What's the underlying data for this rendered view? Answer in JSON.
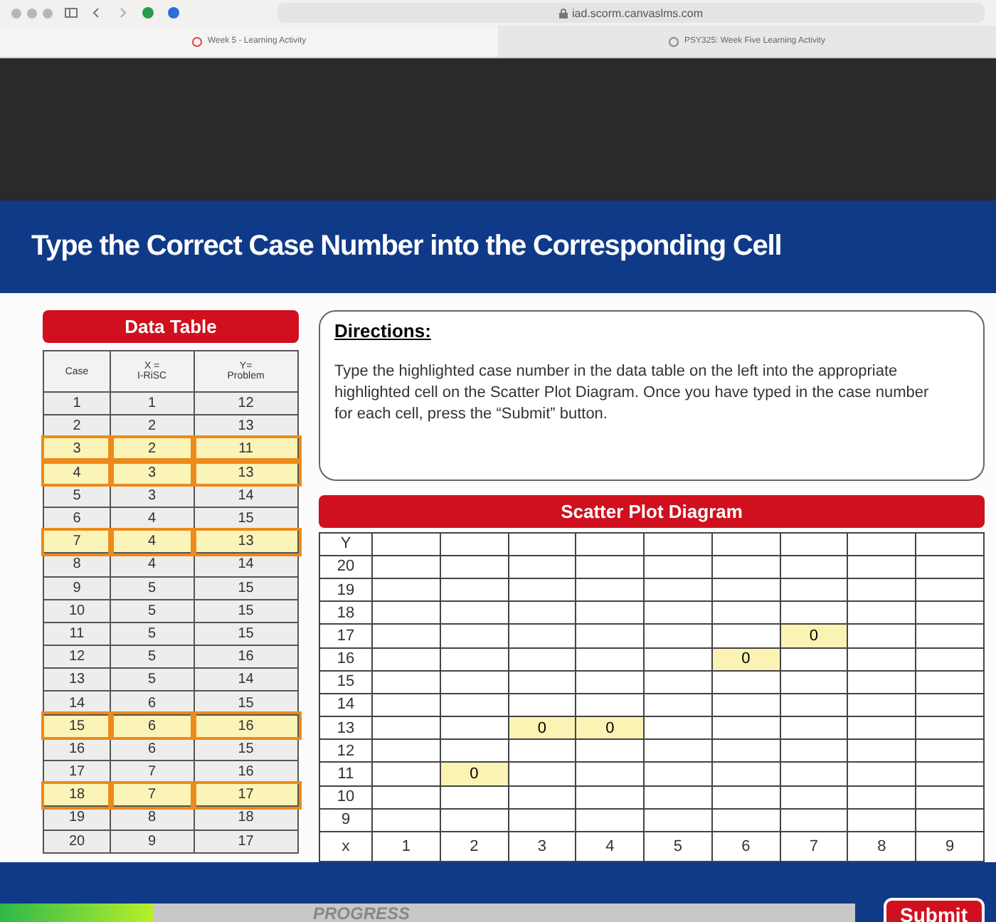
{
  "browser": {
    "url": "iad.scorm.canvaslms.com",
    "tabs": [
      {
        "label": "Week 5 - Learning Activity",
        "selected": true
      },
      {
        "label": "PSY325: Week Five Learning Activity",
        "selected": false
      }
    ]
  },
  "title": "Type the Correct Case Number into the Corresponding Cell",
  "data_table": {
    "title": "Data Table",
    "columns": [
      "Case",
      "X =\nI-RiSC",
      "Y=\nProblem"
    ],
    "rows": [
      {
        "cells": [
          "1",
          "1",
          "12"
        ],
        "highlighted": false
      },
      {
        "cells": [
          "2",
          "2",
          "13"
        ],
        "highlighted": false
      },
      {
        "cells": [
          "3",
          "2",
          "11"
        ],
        "highlighted": true
      },
      {
        "cells": [
          "4",
          "3",
          "13"
        ],
        "highlighted": true
      },
      {
        "cells": [
          "5",
          "3",
          "14"
        ],
        "highlighted": false
      },
      {
        "cells": [
          "6",
          "4",
          "15"
        ],
        "highlighted": false
      },
      {
        "cells": [
          "7",
          "4",
          "13"
        ],
        "highlighted": true
      },
      {
        "cells": [
          "8",
          "4",
          "14"
        ],
        "highlighted": false
      },
      {
        "cells": [
          "9",
          "5",
          "15"
        ],
        "highlighted": false
      },
      {
        "cells": [
          "10",
          "5",
          "15"
        ],
        "highlighted": false
      },
      {
        "cells": [
          "11",
          "5",
          "15"
        ],
        "highlighted": false
      },
      {
        "cells": [
          "12",
          "5",
          "16"
        ],
        "highlighted": false
      },
      {
        "cells": [
          "13",
          "5",
          "14"
        ],
        "highlighted": false
      },
      {
        "cells": [
          "14",
          "6",
          "15"
        ],
        "highlighted": false
      },
      {
        "cells": [
          "15",
          "6",
          "16"
        ],
        "highlighted": true
      },
      {
        "cells": [
          "16",
          "6",
          "15"
        ],
        "highlighted": false
      },
      {
        "cells": [
          "17",
          "7",
          "16"
        ],
        "highlighted": false
      },
      {
        "cells": [
          "18",
          "7",
          "17"
        ],
        "highlighted": true
      },
      {
        "cells": [
          "19",
          "8",
          "18"
        ],
        "highlighted": false
      },
      {
        "cells": [
          "20",
          "9",
          "17"
        ],
        "highlighted": false
      }
    ]
  },
  "directions": {
    "heading": "Directions:",
    "text": "Type the highlighted case number in the data table on the left into the appropriate highlighted cell on the Scatter Plot Diagram. Once you have typed in the case number for each cell, press the “Submit” button."
  },
  "scatter": {
    "title": "Scatter Plot Diagram",
    "y_header": "Y",
    "x_header": "x",
    "x_labels": [
      "1",
      "2",
      "3",
      "4",
      "5",
      "6",
      "7",
      "8",
      "9"
    ],
    "rows": [
      {
        "label": "20",
        "cells": [
          null,
          null,
          null,
          null,
          null,
          null,
          null,
          null,
          null
        ]
      },
      {
        "label": "19",
        "cells": [
          null,
          null,
          null,
          null,
          null,
          null,
          null,
          null,
          null
        ]
      },
      {
        "label": "18",
        "cells": [
          null,
          null,
          null,
          null,
          null,
          null,
          null,
          null,
          null
        ]
      },
      {
        "label": "17",
        "cells": [
          null,
          null,
          null,
          null,
          null,
          null,
          {
            "value": "0"
          },
          null,
          null
        ]
      },
      {
        "label": "16",
        "cells": [
          null,
          null,
          null,
          null,
          null,
          {
            "value": "0"
          },
          null,
          null,
          null
        ]
      },
      {
        "label": "15",
        "cells": [
          null,
          null,
          null,
          null,
          null,
          null,
          null,
          null,
          null
        ]
      },
      {
        "label": "14",
        "cells": [
          null,
          null,
          null,
          null,
          null,
          null,
          null,
          null,
          null
        ]
      },
      {
        "label": "13",
        "cells": [
          null,
          null,
          {
            "value": "0"
          },
          {
            "value": "0"
          },
          null,
          null,
          null,
          null,
          null
        ]
      },
      {
        "label": "12",
        "cells": [
          null,
          null,
          null,
          null,
          null,
          null,
          null,
          null,
          null
        ]
      },
      {
        "label": "11",
        "cells": [
          null,
          {
            "value": "0"
          },
          null,
          null,
          null,
          null,
          null,
          null,
          null
        ]
      },
      {
        "label": "10",
        "cells": [
          null,
          null,
          null,
          null,
          null,
          null,
          null,
          null,
          null
        ]
      },
      {
        "label": "9",
        "cells": [
          null,
          null,
          null,
          null,
          null,
          null,
          null,
          null,
          null
        ]
      }
    ]
  },
  "progress": {
    "label": "PROGRESS",
    "level": 0.18
  },
  "submit": "Submit"
}
